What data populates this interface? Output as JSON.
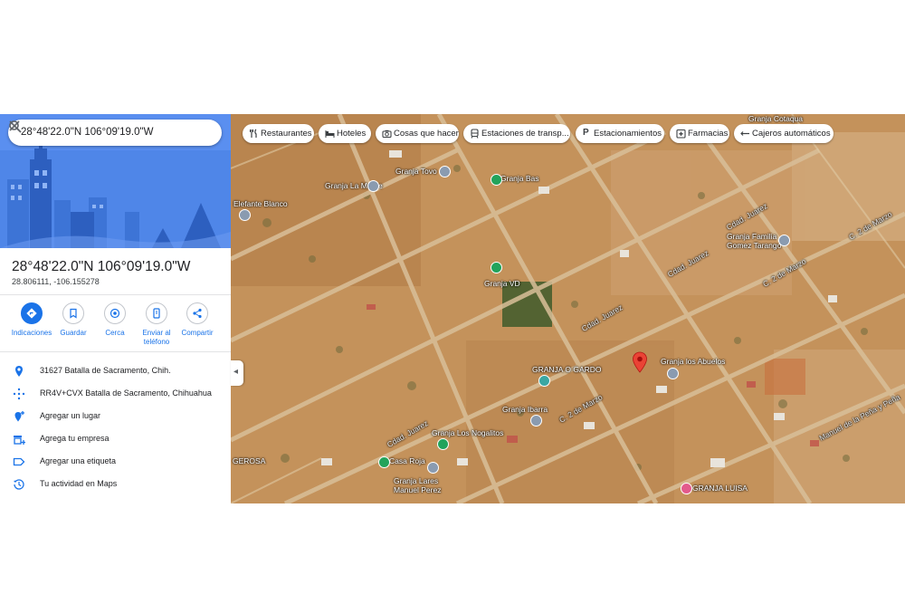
{
  "search": {
    "value": "28°48'22.0\"N 106°09'19.0\"W"
  },
  "place": {
    "title": "28°48'22.0\"N 106°09'19.0\"W",
    "decimal": "28.806111, -106.155278"
  },
  "actions": [
    {
      "label": "Indicaciones",
      "icon": "directions-icon"
    },
    {
      "label": "Guardar",
      "icon": "bookmark-icon"
    },
    {
      "label": "Cerca",
      "icon": "nearby-icon"
    },
    {
      "label": "Enviar al teléfono",
      "icon": "send-to-phone-icon"
    },
    {
      "label": "Compartir",
      "icon": "share-icon"
    }
  ],
  "info": [
    {
      "text": "31627 Batalla de Sacramento, Chih.",
      "icon": "location-icon"
    },
    {
      "text": "RR4V+CVX Batalla de Sacramento, Chihuahua",
      "icon": "plus-code-icon"
    },
    {
      "text": "Agregar un lugar",
      "icon": "add-place-icon"
    },
    {
      "text": "Agrega tu empresa",
      "icon": "add-business-icon"
    },
    {
      "text": "Agregar una etiqueta",
      "icon": "label-icon"
    },
    {
      "text": "Tu actividad en Maps",
      "icon": "history-icon"
    }
  ],
  "chips": [
    {
      "label": "Restaurantes",
      "icon": "fork-knife-icon"
    },
    {
      "label": "Hoteles",
      "icon": "bed-icon"
    },
    {
      "label": "Cosas que hacer",
      "icon": "camera-icon"
    },
    {
      "label": "Estaciones de transp...",
      "icon": "transit-icon"
    },
    {
      "label": "Estacionamientos",
      "icon": "parking-icon"
    },
    {
      "label": "Farmacias",
      "icon": "pharmacy-icon"
    },
    {
      "label": "Cajeros automáticos",
      "icon": "atm-icon"
    }
  ],
  "map_labels": {
    "granja_cotaqua": "Granja Cotaqua",
    "granja_tovo": "Granja Tovo",
    "granja_la_madre": "Granja La Madre",
    "granja_bas": "Granja Bas",
    "elefante_blanco": "Elefante Blanco",
    "cdad_juarez_1": "Cdad. Juarez",
    "cdad_juarez_2": "Cdad. Juarez",
    "cdad_juarez_3": "Cdad. Juarez",
    "cdad_juarez_4": "Cdad. Juarez",
    "granja_familia": "Granja Familia\nGomez Tarango",
    "c2demarzo_1": "C. 2 de Marzo",
    "c2demarzo_2": "C. 2 de Marzo",
    "c2demarzo_3": "C. 2 de Marzo",
    "granja_vd": "Granja VD",
    "granja_o_gardo": "GRANJA O GARDO",
    "granja_los_abuelos": "Granja los Abuelos",
    "granja_ibarra": "Granja Ibarra",
    "granja_nogalitos": "Granja Los Nogalitos",
    "casa_roja": "Casa Roja",
    "granja_manuel": "Granja Lares\nManuel Perez",
    "granja_luisa": "GRANJA LUISA",
    "manuel_de_la_pena": "Manuel de la Peña y Peña",
    "gerosa": "GEROSA"
  },
  "colors": {
    "accent": "#1a73e8",
    "hero": "#4f86e8",
    "pin": "#ea4335"
  }
}
